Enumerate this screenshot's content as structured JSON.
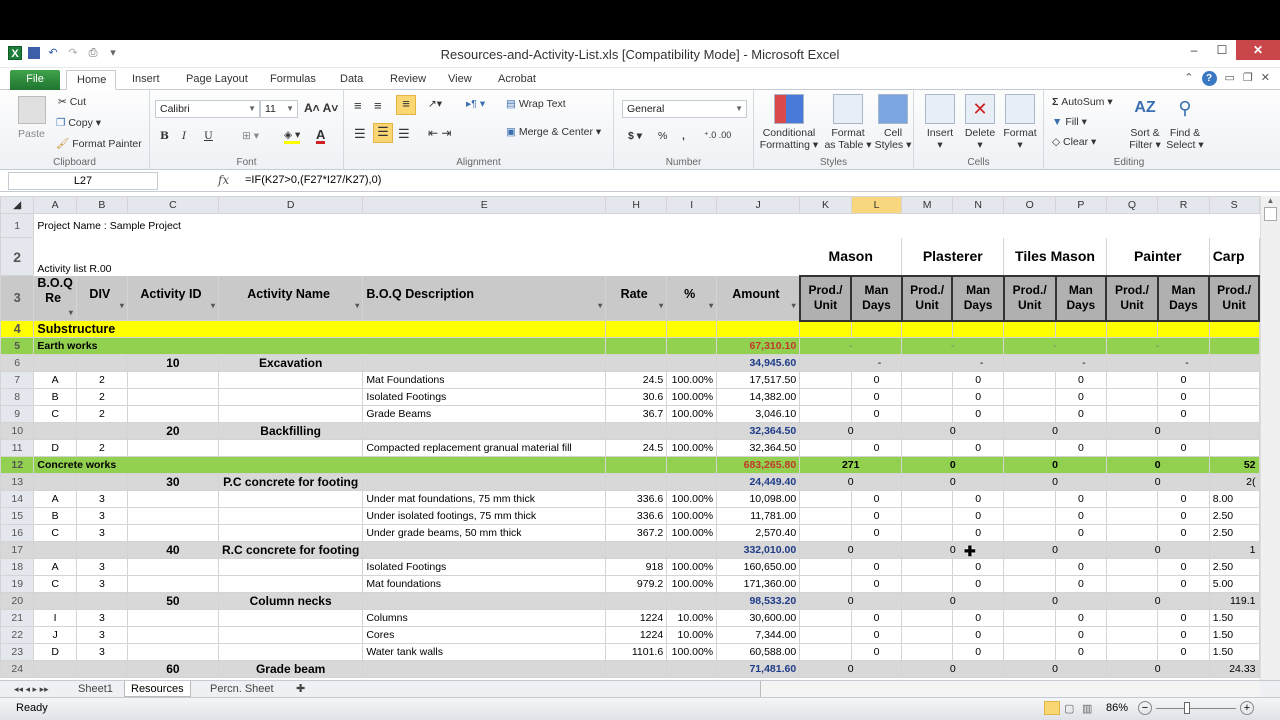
{
  "window": {
    "title": "Resources-and-Activity-List.xls  [Compatibility Mode]  -  Microsoft Excel"
  },
  "ribbon_tabs": [
    "File",
    "Home",
    "Insert",
    "Page Layout",
    "Formulas",
    "Data",
    "Review",
    "View",
    "Acrobat"
  ],
  "clipboard": {
    "paste": "Paste",
    "cut": "Cut",
    "copy": "Copy",
    "format_painter": "Format Painter",
    "label": "Clipboard"
  },
  "font": {
    "name": "Calibri",
    "size": "11",
    "label": "Font",
    "bold": "B",
    "italic": "I",
    "underline": "U"
  },
  "alignment": {
    "wrap_text": "Wrap Text",
    "merge_center": "Merge & Center",
    "label": "Alignment"
  },
  "number": {
    "format": "General",
    "currency": "$",
    "percent": "%",
    "comma": ",",
    "inc_dec": ".00",
    "label": "Number"
  },
  "styles": {
    "conditional": "Conditional",
    "conditional2": "Formatting",
    "format_table": "Format",
    "format_table2": "as Table",
    "cell_styles": "Cell",
    "cell_styles2": "Styles",
    "label": "Styles"
  },
  "cells": {
    "insert": "Insert",
    "delete": "Delete",
    "format": "Format",
    "label": "Cells"
  },
  "editing": {
    "autosum": "AutoSum",
    "fill": "Fill",
    "clear": "Clear",
    "sort": "Sort &",
    "sort2": "Filter",
    "find": "Find &",
    "find2": "Select",
    "label": "Editing"
  },
  "formula_bar": {
    "name_box": "L27",
    "fx": "fx",
    "formula": "=IF(K27>0,(F27*I27/K27),0)"
  },
  "columns": [
    "A",
    "B",
    "C",
    "D",
    "E",
    "H",
    "I",
    "J",
    "K",
    "L",
    "M",
    "N",
    "O",
    "P",
    "Q",
    "R",
    "S"
  ],
  "selected_column": "L",
  "row1": "Project Name : Sample Project",
  "row2": "Activity list R.00",
  "headers": {
    "boq_ref": "B.O.Q Re",
    "div": "DIV",
    "activity_id": "Activity ID",
    "activity_name": "Activity Name",
    "boq_desc": "B.O.Q Description",
    "rate": "Rate",
    "pct": "%",
    "amount": "Amount"
  },
  "trades": [
    "Mason",
    "Plasterer",
    "Tiles Mason",
    "Painter",
    "Carp"
  ],
  "sub_headers": {
    "prod": "Prod./ Unit",
    "man": "Man Days"
  },
  "rows": [
    {
      "n": "4",
      "type": "section",
      "label": "Substructure"
    },
    {
      "n": "5",
      "type": "group",
      "label": "Earth works",
      "amount": "67,310.10",
      "vals": [
        "-",
        "-",
        "-",
        "-",
        ""
      ]
    },
    {
      "n": "6",
      "type": "activity",
      "id": "10",
      "name": "Excavation",
      "amount": "34,945.60",
      "vals": [
        "-",
        "-",
        "-",
        "-",
        ""
      ]
    },
    {
      "n": "7",
      "type": "item",
      "ref": "A",
      "div": "2",
      "desc": "Mat Foundations",
      "rate": "24.5",
      "pct": "100.00%",
      "amount": "17,517.50",
      "man": [
        "0",
        "0",
        "0",
        "0"
      ],
      "s": ""
    },
    {
      "n": "8",
      "type": "item",
      "ref": "B",
      "div": "2",
      "desc": "Isolated Footings",
      "rate": "30.6",
      "pct": "100.00%",
      "amount": "14,382.00",
      "man": [
        "0",
        "0",
        "0",
        "0"
      ],
      "s": ""
    },
    {
      "n": "9",
      "type": "item",
      "ref": "C",
      "div": "2",
      "desc": "Grade Beams",
      "rate": "36.7",
      "pct": "100.00%",
      "amount": "3,046.10",
      "man": [
        "0",
        "0",
        "0",
        "0"
      ],
      "s": ""
    },
    {
      "n": "10",
      "type": "activity",
      "id": "20",
      "name": "Backfilling",
      "amount": "32,364.50",
      "vals": [
        "0",
        "0",
        "0",
        "0",
        ""
      ]
    },
    {
      "n": "11",
      "type": "item",
      "ref": "D",
      "div": "2",
      "desc": "Compacted replacement granual material fill",
      "rate": "24.5",
      "pct": "100.00%",
      "amount": "32,364.50",
      "man": [
        "0",
        "0",
        "0",
        "0"
      ],
      "s": ""
    },
    {
      "n": "12",
      "type": "group",
      "label": "Concrete works",
      "amount": "683,265.80",
      "vals": [
        "271",
        "0",
        "0",
        "0",
        "52"
      ]
    },
    {
      "n": "13",
      "type": "activity",
      "id": "30",
      "name": "P.C concrete for footing",
      "amount": "24,449.40",
      "vals": [
        "0",
        "0",
        "0",
        "0",
        "2("
      ]
    },
    {
      "n": "14",
      "type": "item",
      "ref": "A",
      "div": "3",
      "desc": "Under mat foundations, 75 mm thick",
      "rate": "336.6",
      "pct": "100.00%",
      "amount": "10,098.00",
      "man": [
        "0",
        "0",
        "0",
        "0"
      ],
      "s": "8.00"
    },
    {
      "n": "15",
      "type": "item",
      "ref": "B",
      "div": "3",
      "desc": "Under isolated footings, 75 mm thick",
      "rate": "336.6",
      "pct": "100.00%",
      "amount": "11,781.00",
      "man": [
        "0",
        "0",
        "0",
        "0"
      ],
      "s": "2.50"
    },
    {
      "n": "16",
      "type": "item",
      "ref": "C",
      "div": "3",
      "desc": "Under grade beams, 50 mm thick",
      "rate": "367.2",
      "pct": "100.00%",
      "amount": "2,570.40",
      "man": [
        "0",
        "0",
        "0",
        "0"
      ],
      "s": "2.50"
    },
    {
      "n": "17",
      "type": "activity",
      "id": "40",
      "name": "R.C concrete for footing",
      "amount": "332,010.00",
      "vals": [
        "0",
        "0",
        "0",
        "0",
        "1"
      ]
    },
    {
      "n": "18",
      "type": "item",
      "ref": "A",
      "div": "3",
      "desc": "Isolated Footings",
      "rate": "918",
      "pct": "100.00%",
      "amount": "160,650.00",
      "man": [
        "0",
        "0",
        "0",
        "0"
      ],
      "s": "2.50"
    },
    {
      "n": "19",
      "type": "item",
      "ref": "C",
      "div": "3",
      "desc": "Mat foundations",
      "rate": "979.2",
      "pct": "100.00%",
      "amount": "171,360.00",
      "man": [
        "0",
        "0",
        "0",
        "0"
      ],
      "s": "5.00"
    },
    {
      "n": "20",
      "type": "activity",
      "id": "50",
      "name": "Column necks",
      "amount": "98,533.20",
      "vals": [
        "0",
        "0",
        "0",
        "0",
        "119.1"
      ]
    },
    {
      "n": "21",
      "type": "item",
      "ref": "I",
      "div": "3",
      "desc": "Columns",
      "rate": "1224",
      "pct": "10.00%",
      "amount": "30,600.00",
      "man": [
        "0",
        "0",
        "0",
        "0"
      ],
      "s": "1.50"
    },
    {
      "n": "22",
      "type": "item",
      "ref": "J",
      "div": "3",
      "desc": "Cores",
      "rate": "1224",
      "pct": "10.00%",
      "amount": "7,344.00",
      "man": [
        "0",
        "0",
        "0",
        "0"
      ],
      "s": "1.50"
    },
    {
      "n": "23",
      "type": "item",
      "ref": "D",
      "div": "3",
      "desc": "Water tank walls",
      "rate": "1101.6",
      "pct": "100.00%",
      "amount": "60,588.00",
      "man": [
        "0",
        "0",
        "0",
        "0"
      ],
      "s": "1.50"
    },
    {
      "n": "24",
      "type": "activity",
      "id": "60",
      "name": "Grade beam",
      "amount": "71,481.60",
      "vals": [
        "0",
        "0",
        "0",
        "0",
        "24.33"
      ]
    }
  ],
  "sheet_tabs": [
    "Sheet1",
    "Resources",
    "Percn. Sheet"
  ],
  "active_sheet": "Resources",
  "status": {
    "ready": "Ready",
    "zoom": "86%"
  }
}
